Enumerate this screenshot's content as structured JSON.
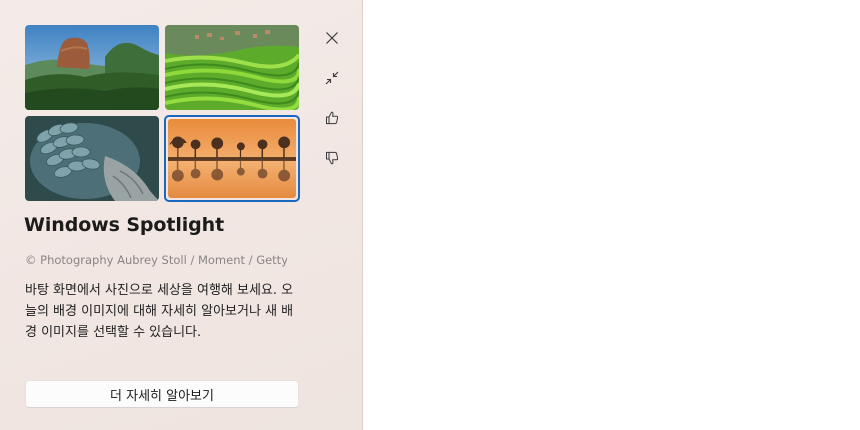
{
  "spotlight": {
    "title": "Windows Spotlight",
    "credit": "© Photography Aubrey Stoll / Moment / Getty...",
    "description": "바탕 화면에서 사진으로 세상을 여행해 보세요. 오늘의 배경 이미지에 대해 자세히 알아보거나 새 배경 이미지를 선택할 수 있습니다.",
    "learn_more_label": "더 자세히 알아보기",
    "selected_thumbnail_index": 3
  },
  "thumbnails": [
    {
      "subject": "rock-fortress-jungle"
    },
    {
      "subject": "rice-terraces"
    },
    {
      "subject": "parrot-feathers"
    },
    {
      "subject": "sunset-lake-reflection"
    }
  ],
  "side_actions": [
    {
      "icon": "close-icon"
    },
    {
      "icon": "collapse-icon"
    },
    {
      "icon": "thumbs-up-icon"
    },
    {
      "icon": "thumbs-down-icon"
    }
  ],
  "colors": {
    "accent": "#1a67c0",
    "panel_background": "#f1e6e2"
  }
}
